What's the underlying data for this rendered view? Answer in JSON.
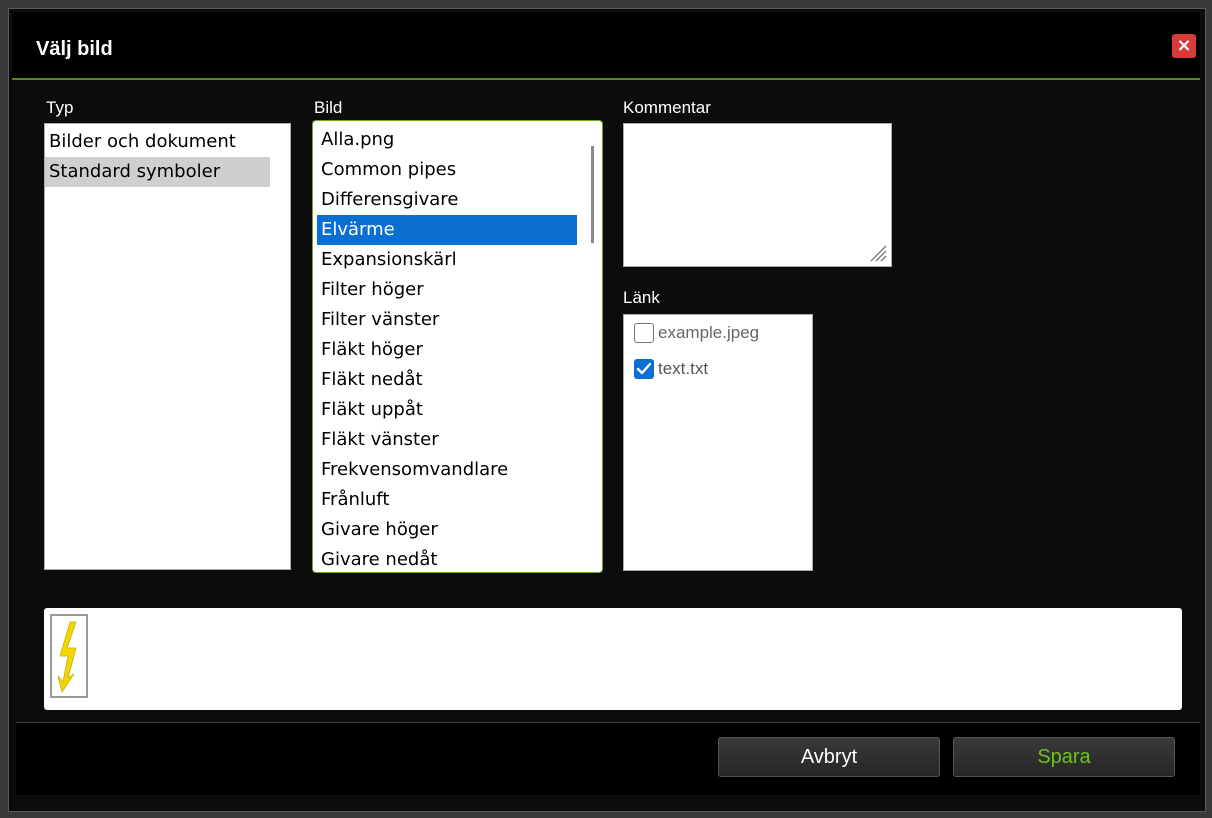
{
  "dialog": {
    "title": "Välj bild",
    "close_label": "×"
  },
  "typ": {
    "label": "Typ",
    "items": [
      "Bilder och dokument",
      "Standard symboler"
    ],
    "selected_index": 1
  },
  "bild": {
    "label": "Bild",
    "items": [
      "Alla.png",
      "Common pipes",
      "Differensgivare",
      "Elvärme",
      "Expansionskärl",
      "Filter höger",
      "Filter vänster",
      "Fläkt höger",
      "Fläkt nedåt",
      "Fläkt uppåt",
      "Fläkt vänster",
      "Frekvensomvandlare",
      "Frånluft",
      "Givare höger",
      "Givare nedåt"
    ],
    "selected_index": 3
  },
  "kommentar": {
    "label": "Kommentar",
    "value": ""
  },
  "lank": {
    "label": "Länk",
    "items": [
      {
        "label": "example.jpeg",
        "checked": false
      },
      {
        "label": "text.txt",
        "checked": true
      }
    ]
  },
  "preview": {
    "icon": "lightning-bolt-icon"
  },
  "buttons": {
    "cancel": "Avbryt",
    "save": "Spara"
  },
  "colors": {
    "accent_green": "#5c8a16",
    "save_text": "#6fc21d",
    "selection_blue": "#0a6fd1",
    "close_red": "#d93a3a",
    "bolt_yellow": "#f2d600"
  }
}
